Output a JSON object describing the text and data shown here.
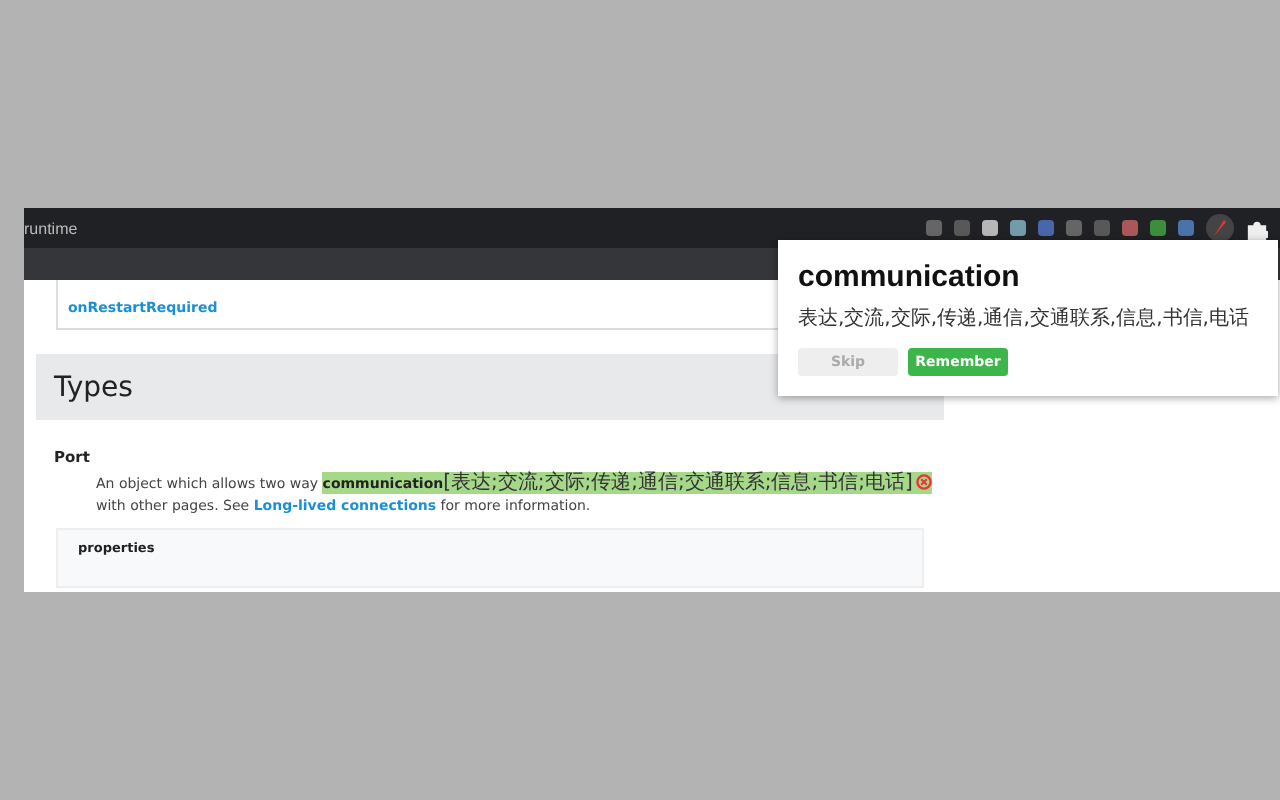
{
  "browser": {
    "tab_title": "runtime"
  },
  "page": {
    "top_link": "onRestartRequired",
    "section_title": "Types",
    "type_name": "Port",
    "description": {
      "before": "An object which allows two way ",
      "word": "communication",
      "annotation": "[表达;交流;交际;传递;通信;交通联系;信息;书信;电话]",
      "after": " with other pages. See ",
      "link": "Long-lived connections",
      "tail": " for more information."
    },
    "properties_label": "properties"
  },
  "popup": {
    "word": "communication",
    "meaning": "表达,交流,交际,传递,通信,交通联系,信息,书信,电话",
    "buttons": [
      {
        "label": "Skip",
        "kind": "secondary"
      },
      {
        "label": "Remember",
        "kind": "primary"
      }
    ]
  }
}
